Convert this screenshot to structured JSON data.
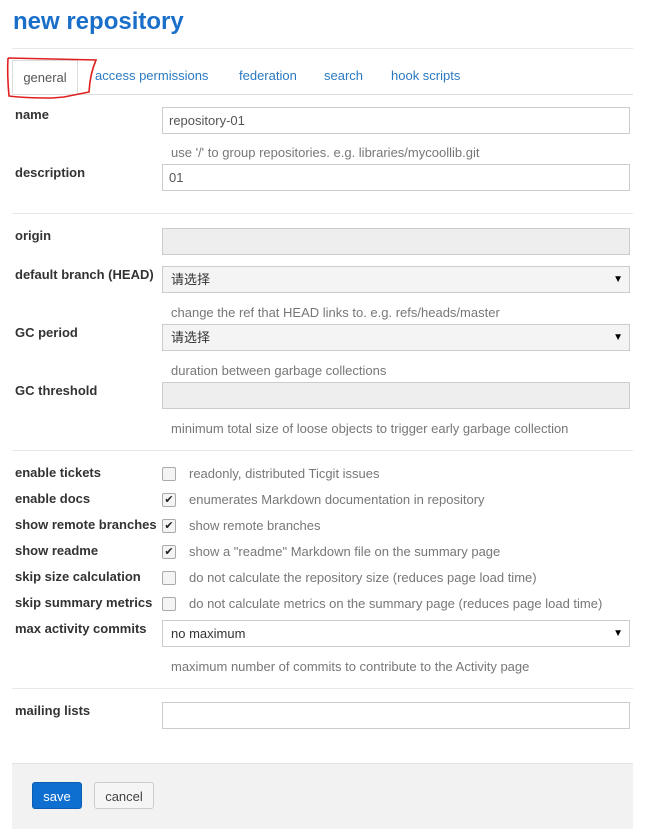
{
  "title": "new repository",
  "tabs": [
    "general",
    "access permissions",
    "federation",
    "search",
    "hook scripts"
  ],
  "active_tab": "general",
  "fields": {
    "name": {
      "label": "name",
      "value": "repository-01",
      "help": "use '/' to group repositories. e.g. libraries/mycoollib.git"
    },
    "description": {
      "label": "description",
      "value": "01"
    },
    "origin": {
      "label": "origin",
      "value": ""
    },
    "head": {
      "label": "default branch (HEAD)",
      "value": "请选择",
      "help": "change the ref that HEAD links to. e.g. refs/heads/master"
    },
    "gc_period": {
      "label": "GC period",
      "value": "请选择",
      "help": "duration between garbage collections"
    },
    "gc_threshold": {
      "label": "GC threshold",
      "value": "",
      "help": "minimum total size of loose objects to trigger early garbage collection"
    },
    "max_commits": {
      "label": "max activity commits",
      "value": "no maximum",
      "help": "maximum number of commits to contribute to the Activity page"
    },
    "mailing": {
      "label": "mailing lists",
      "value": ""
    }
  },
  "checkboxes": [
    {
      "label": "enable tickets",
      "checked": false,
      "text": "readonly, distributed Ticgit issues"
    },
    {
      "label": "enable docs",
      "checked": true,
      "text": "enumerates Markdown documentation in repository"
    },
    {
      "label": "show remote branches",
      "checked": true,
      "text": "show remote branches"
    },
    {
      "label": "show readme",
      "checked": true,
      "text": "show a \"readme\" Markdown file on the summary page"
    },
    {
      "label": "skip size calculation",
      "checked": false,
      "text": "do not calculate the repository size (reduces page load time)"
    },
    {
      "label": "skip summary metrics",
      "checked": false,
      "text": "do not calculate metrics on the summary page (reduces page load time)"
    }
  ],
  "buttons": {
    "save": "save",
    "cancel": "cancel"
  },
  "colors": {
    "accent": "#1a6fc9",
    "save": "#0e6fd0",
    "annotation": "#e02020"
  }
}
